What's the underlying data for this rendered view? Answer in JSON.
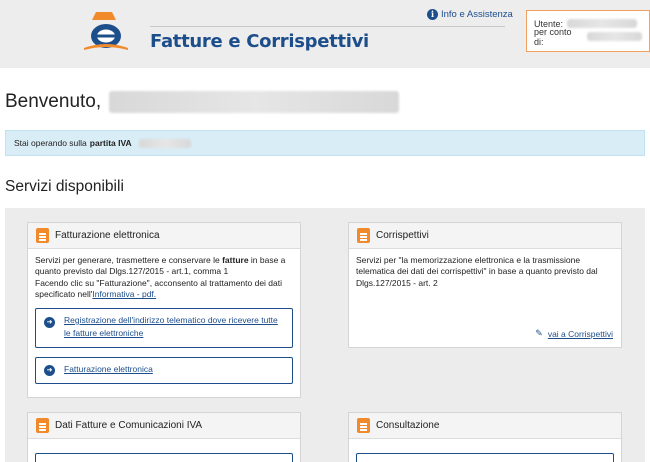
{
  "header": {
    "app_title": "Fatture e Corrispettivi",
    "info_link": "Info e Assistenza",
    "user_label": "Utente:",
    "on_behalf_label": "per conto di:"
  },
  "welcome": {
    "text": "Benvenuto,"
  },
  "alert": {
    "prefix": "Stai operando sulla",
    "bold": "partita IVA"
  },
  "services_title": "Servizi disponibili",
  "cards": {
    "fatturazione": {
      "title": "Fatturazione elettronica",
      "desc_1": "Servizi per generare, trasmettere e conservare le ",
      "desc_bold": "fatture",
      "desc_2": " in base a quanto previsto dal Dlgs.127/2015 - art.1, comma 1",
      "desc_3": "Facendo clic su \"Fatturazione\", acconsento al trattamento dei dati specificato nell'",
      "informativa_link": "Informativa - pdf.",
      "btn_registrazione": "Registrazione dell'indirizzo telematico dove ricevere tutte le fatture elettroniche",
      "btn_fatturazione": "Fatturazione elettronica"
    },
    "corrispettivi": {
      "title": "Corrispettivi",
      "desc": "Servizi per \"la memorizzazione elettronica e la trasmissione telematica dei dati dei corrispettivi\" in base a quanto previsto dal Dlgs.127/2015 - art. 2",
      "link": "vai a Corrispettivi"
    },
    "dati_fatture": {
      "title": "Dati Fatture e Comunicazioni IVA"
    },
    "consultazione": {
      "title": "Consultazione"
    }
  },
  "icons": {
    "logo": "agenzia-entrate-logo",
    "info": "info-icon",
    "card": "document-icon",
    "arrow": "arrow-right-circle-icon",
    "edit": "edit-icon"
  },
  "colors": {
    "brand_blue": "#1d4e8c",
    "accent_orange": "#f08a2a",
    "alert_bg": "#d9edf6"
  }
}
